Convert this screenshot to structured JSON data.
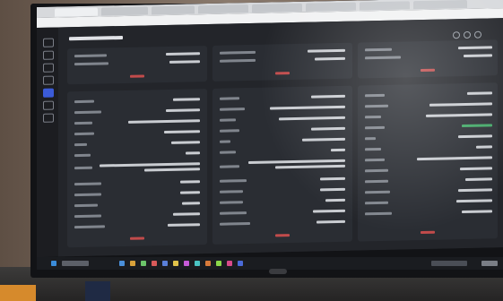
{
  "scene": {
    "description_free": true
  }
}
